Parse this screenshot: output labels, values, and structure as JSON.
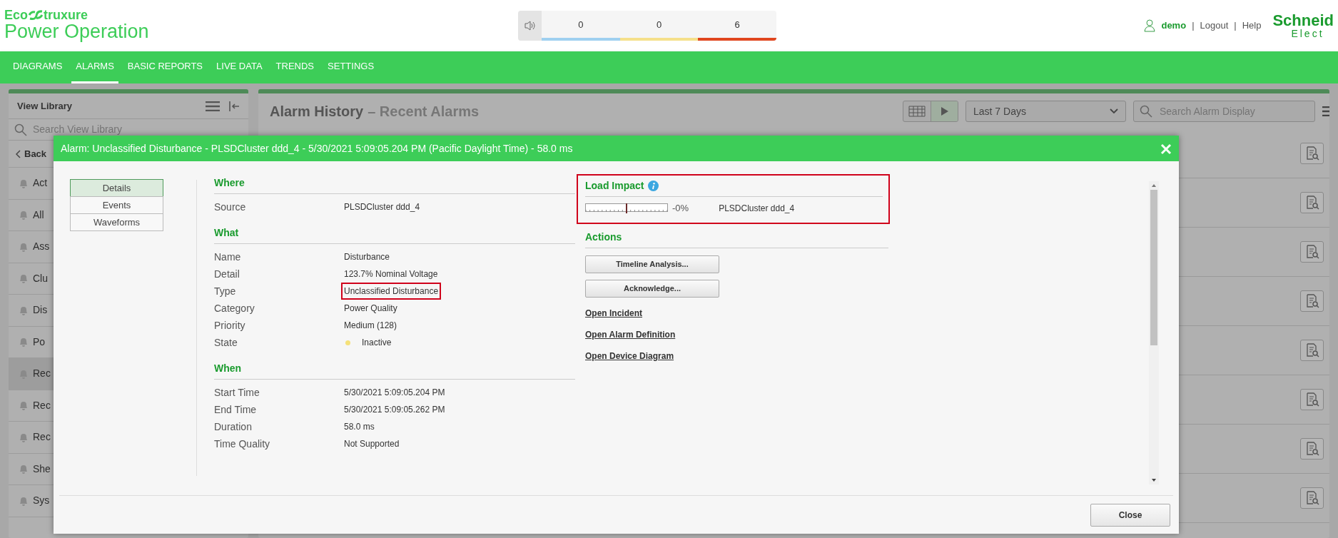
{
  "header": {
    "logo_left": "Eco",
    "logo_right": "truxure",
    "product": "Power Operation",
    "alarm_counts": [
      {
        "value": "0",
        "color": "#9fd0f0"
      },
      {
        "value": "0",
        "color": "#f5e08a"
      },
      {
        "value": "6",
        "color": "#e0461e"
      }
    ],
    "user": "demo",
    "separator": "|",
    "links": [
      "Logout",
      "Help"
    ],
    "brand_top": "Schneid",
    "brand_bottom": "Elect"
  },
  "nav": [
    {
      "label": "DIAGRAMS",
      "selected": false
    },
    {
      "label": "ALARMS",
      "selected": true
    },
    {
      "label": "BASIC REPORTS",
      "selected": false
    },
    {
      "label": "LIVE DATA",
      "selected": false
    },
    {
      "label": "TRENDS",
      "selected": false
    },
    {
      "label": "SETTINGS",
      "selected": false
    }
  ],
  "sidebar": {
    "title": "View Library",
    "search": {
      "placeholder": "Search View Library"
    },
    "back": "Back",
    "items": [
      {
        "label": "Act",
        "selected": false
      },
      {
        "label": "All",
        "selected": false
      },
      {
        "label": "Ass",
        "selected": false
      },
      {
        "label": "Clu",
        "selected": false
      },
      {
        "label": "Dis",
        "selected": false
      },
      {
        "label": "Po",
        "selected": false
      },
      {
        "label": "Rec",
        "selected": true
      },
      {
        "label": "Rec",
        "selected": false
      },
      {
        "label": "Rec",
        "selected": false
      },
      {
        "label": "She",
        "selected": false
      },
      {
        "label": "Sys",
        "selected": false
      }
    ]
  },
  "main": {
    "title": "Alarm History",
    "subtitle": "– Recent Alarms",
    "range": "Last 7 Days",
    "search": {
      "placeholder": "Search Alarm Display"
    }
  },
  "modal": {
    "title": "Alarm: Unclassified Disturbance - PLSDCluster ddd_4 - 5/30/2021 5:09:05.204 PM (Pacific Daylight Time) - 58.0 ms",
    "tabs": [
      {
        "label": "Details",
        "selected": true
      },
      {
        "label": "Events",
        "selected": false
      },
      {
        "label": "Waveforms",
        "selected": false
      }
    ],
    "sections": [
      {
        "heading": "Where",
        "fields": [
          {
            "label": "Source",
            "value": "PLSDCluster ddd_4",
            "highlighted": false
          }
        ]
      },
      {
        "heading": "What",
        "fields": [
          {
            "label": "Name",
            "value": "Disturbance",
            "highlighted": false
          },
          {
            "label": "Detail",
            "value": "123.7% Nominal Voltage",
            "highlighted": false
          },
          {
            "label": "Type",
            "value": "Unclassified Disturbance",
            "highlighted": true
          },
          {
            "label": "Category",
            "value": "Power Quality",
            "highlighted": false
          },
          {
            "label": "Priority",
            "value": "Medium (128)",
            "highlighted": false
          },
          {
            "label": "State",
            "value": "Inactive",
            "color": "#f5e17a",
            "highlighted": false
          }
        ]
      },
      {
        "heading": "When",
        "fields": [
          {
            "label": "Start Time",
            "value": "5/30/2021 5:09:05.204 PM",
            "highlighted": false
          },
          {
            "label": "End Time",
            "value": "5/30/2021 5:09:05.262 PM",
            "highlighted": false
          },
          {
            "label": "Duration",
            "value": "58.0 ms",
            "highlighted": false
          },
          {
            "label": "Time Quality",
            "value": "Not Supported",
            "highlighted": false
          }
        ]
      }
    ],
    "load_impact": {
      "heading": "Load Impact",
      "highlighted": true,
      "level": 0.5,
      "reading": "-0%",
      "source": "PLSDCluster ddd_4"
    },
    "actions": {
      "heading": "Actions",
      "buttons": [
        "Timeline Analysis...",
        "Acknowledge..."
      ],
      "links": [
        "Open Incident",
        "Open Alarm Definition",
        "Open Device Diagram"
      ]
    },
    "close": "Close"
  }
}
